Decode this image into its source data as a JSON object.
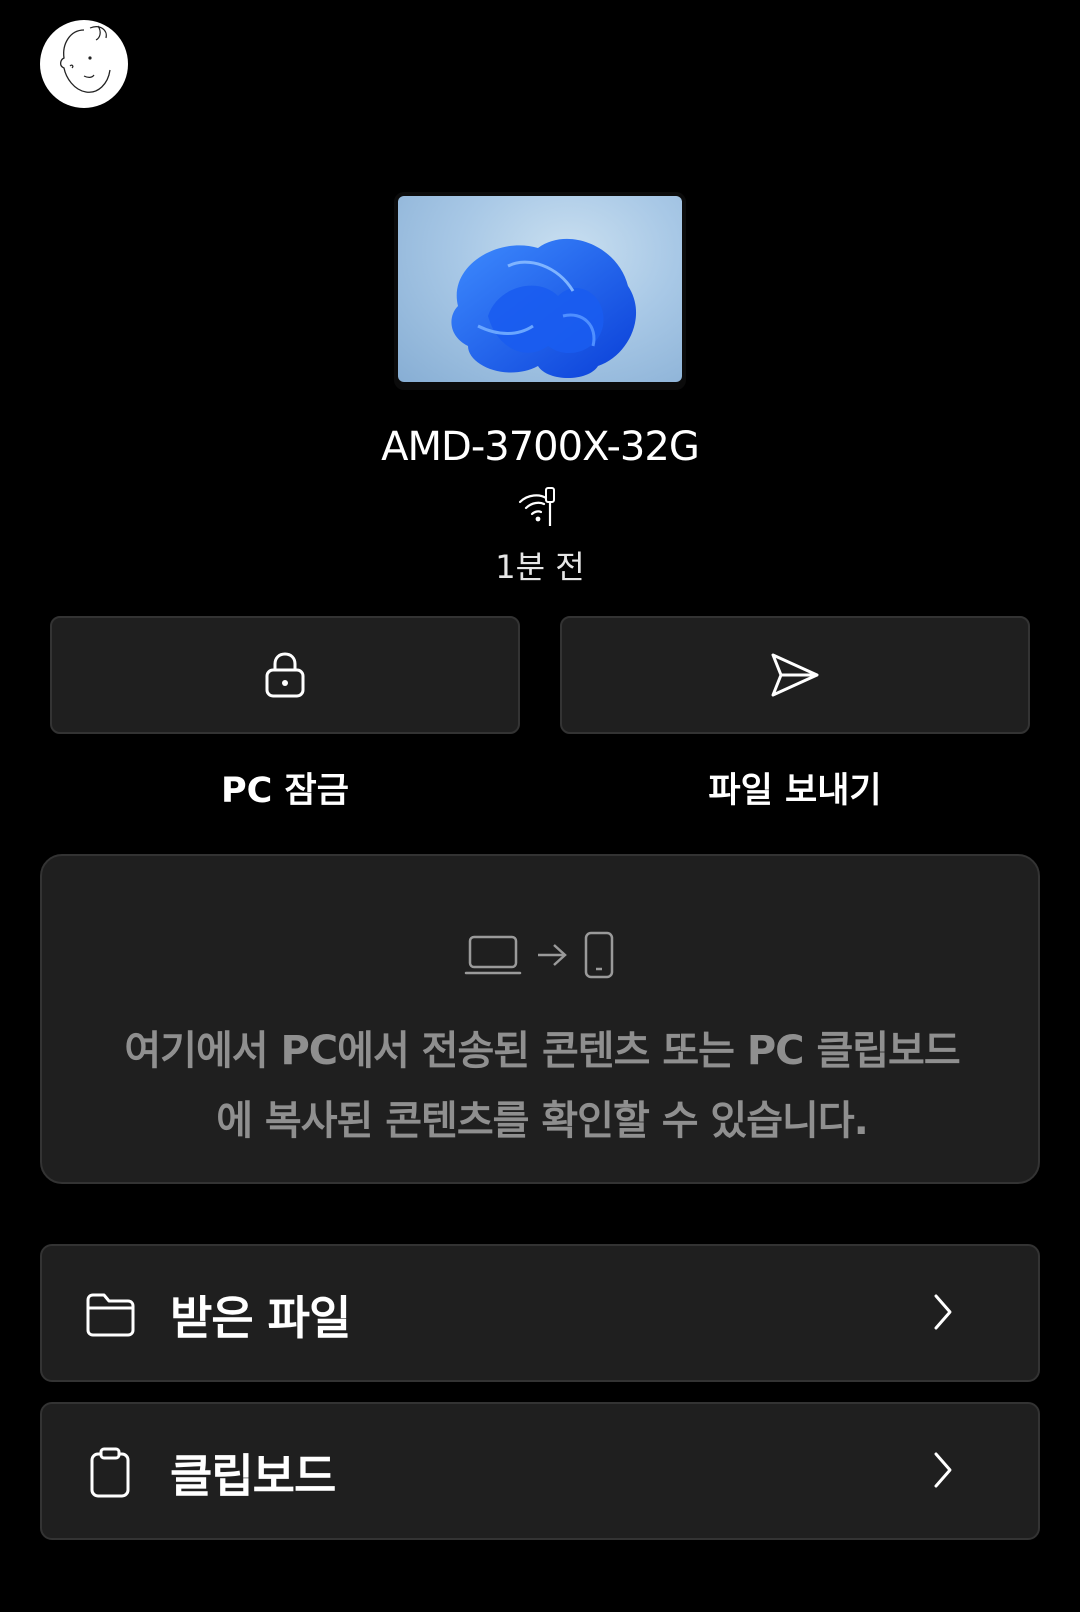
{
  "device": {
    "name": "AMD-3700X-32G",
    "last_seen": "1분 전",
    "connection_icon": "wifi-cable-icon"
  },
  "actions": {
    "lock_label": "PC 잠금",
    "lock_icon": "lock-icon",
    "send_label": "파일 보내기",
    "send_icon": "send-icon"
  },
  "info": {
    "line1": "여기에서 PC에서 전송된 콘텐츠 또는 PC 클립보드",
    "line2": "에 복사된 콘텐츠를 확인할 수 있습니다.",
    "icons": [
      "laptop-icon",
      "arrow-right-icon",
      "phone-icon"
    ]
  },
  "list": {
    "received_files_label": "받은 파일",
    "received_files_icon": "folder-icon",
    "clipboard_label": "클립보드",
    "clipboard_icon": "clipboard-icon"
  },
  "colors": {
    "background": "#000000",
    "card": "#1f1f1f",
    "border": "#333333",
    "muted_text": "#8f8f8f"
  }
}
